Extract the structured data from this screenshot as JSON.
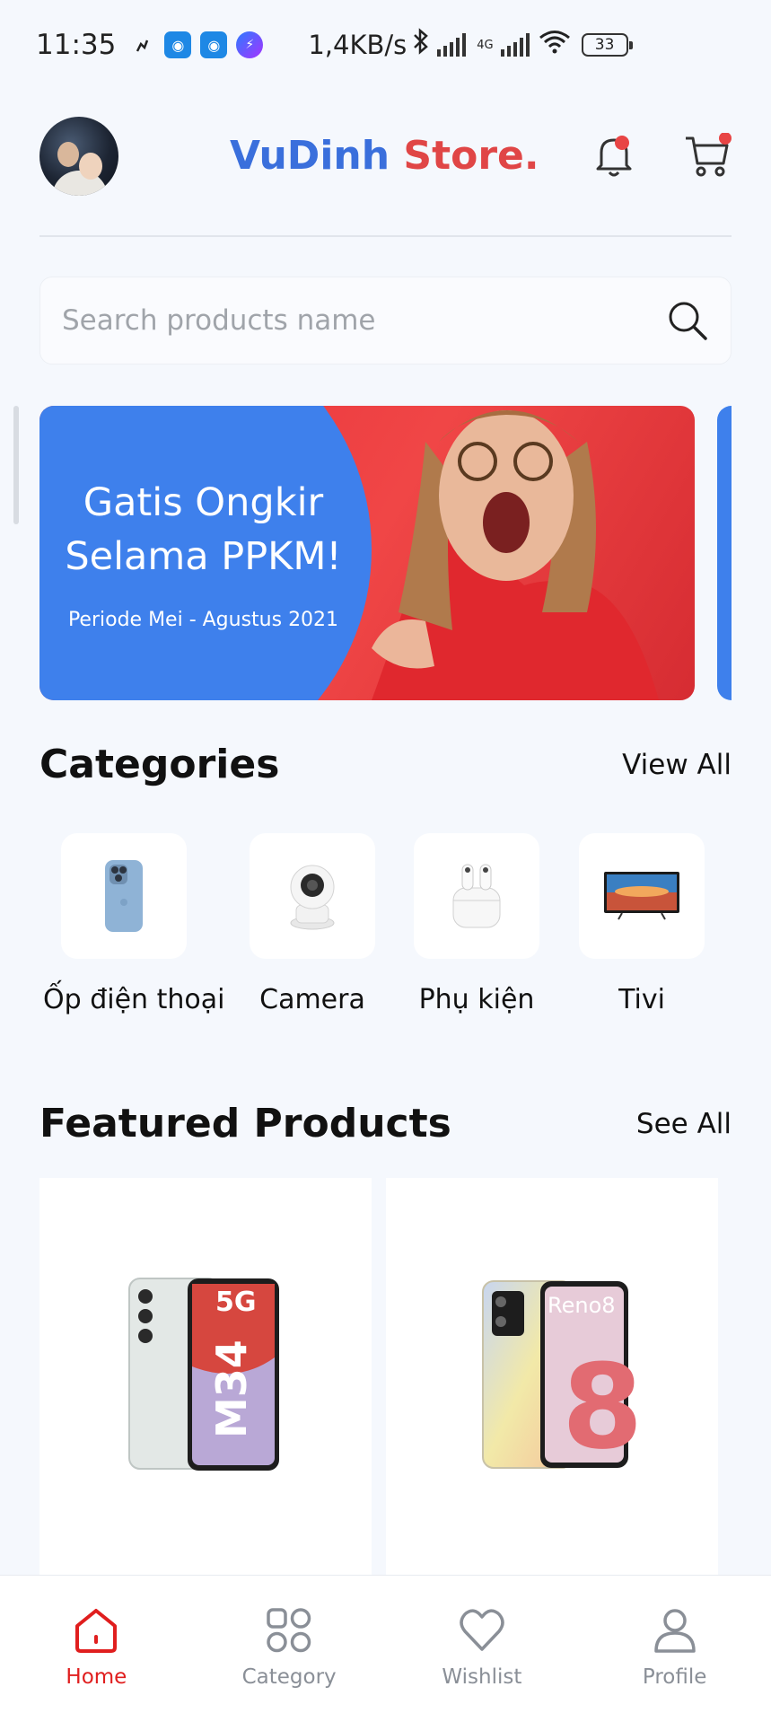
{
  "status_bar": {
    "time": "11:35",
    "speed": "1,4KB/s",
    "network": "4G",
    "battery": "33"
  },
  "header": {
    "brand_primary": "VuDinh",
    "brand_secondary": "Store.",
    "brand_primary_color": "#3A6FDC",
    "brand_secondary_color": "#E04646"
  },
  "search": {
    "placeholder": "Search products name"
  },
  "banner": {
    "title_line1": "Gatis Ongkir",
    "title_line2": "Selama PPKM!",
    "subtitle": "Periode Mei - Agustus 2021"
  },
  "categories": {
    "title": "Categories",
    "view_all": "View All",
    "items": [
      {
        "label": "Ốp điện thoại",
        "icon": "phone-case-icon"
      },
      {
        "label": "Camera",
        "icon": "security-camera-icon"
      },
      {
        "label": "Phụ kiện",
        "icon": "earbuds-icon"
      },
      {
        "label": "Tivi",
        "icon": "tv-icon"
      }
    ]
  },
  "featured": {
    "title": "Featured Products",
    "see_all": "See All",
    "items": [
      {
        "image": "samsung-m34-phone-image",
        "badge_text": "M34 5G"
      },
      {
        "image": "oppo-reno8-phone-image",
        "badge_text": "Reno8"
      }
    ]
  },
  "bottom_nav": {
    "items": [
      {
        "label": "Home",
        "icon": "home-icon",
        "active": true
      },
      {
        "label": "Category",
        "icon": "grid-icon",
        "active": false
      },
      {
        "label": "Wishlist",
        "icon": "heart-icon",
        "active": false
      },
      {
        "label": "Profile",
        "icon": "user-icon",
        "active": false
      }
    ],
    "active_color": "#E01E1E"
  }
}
